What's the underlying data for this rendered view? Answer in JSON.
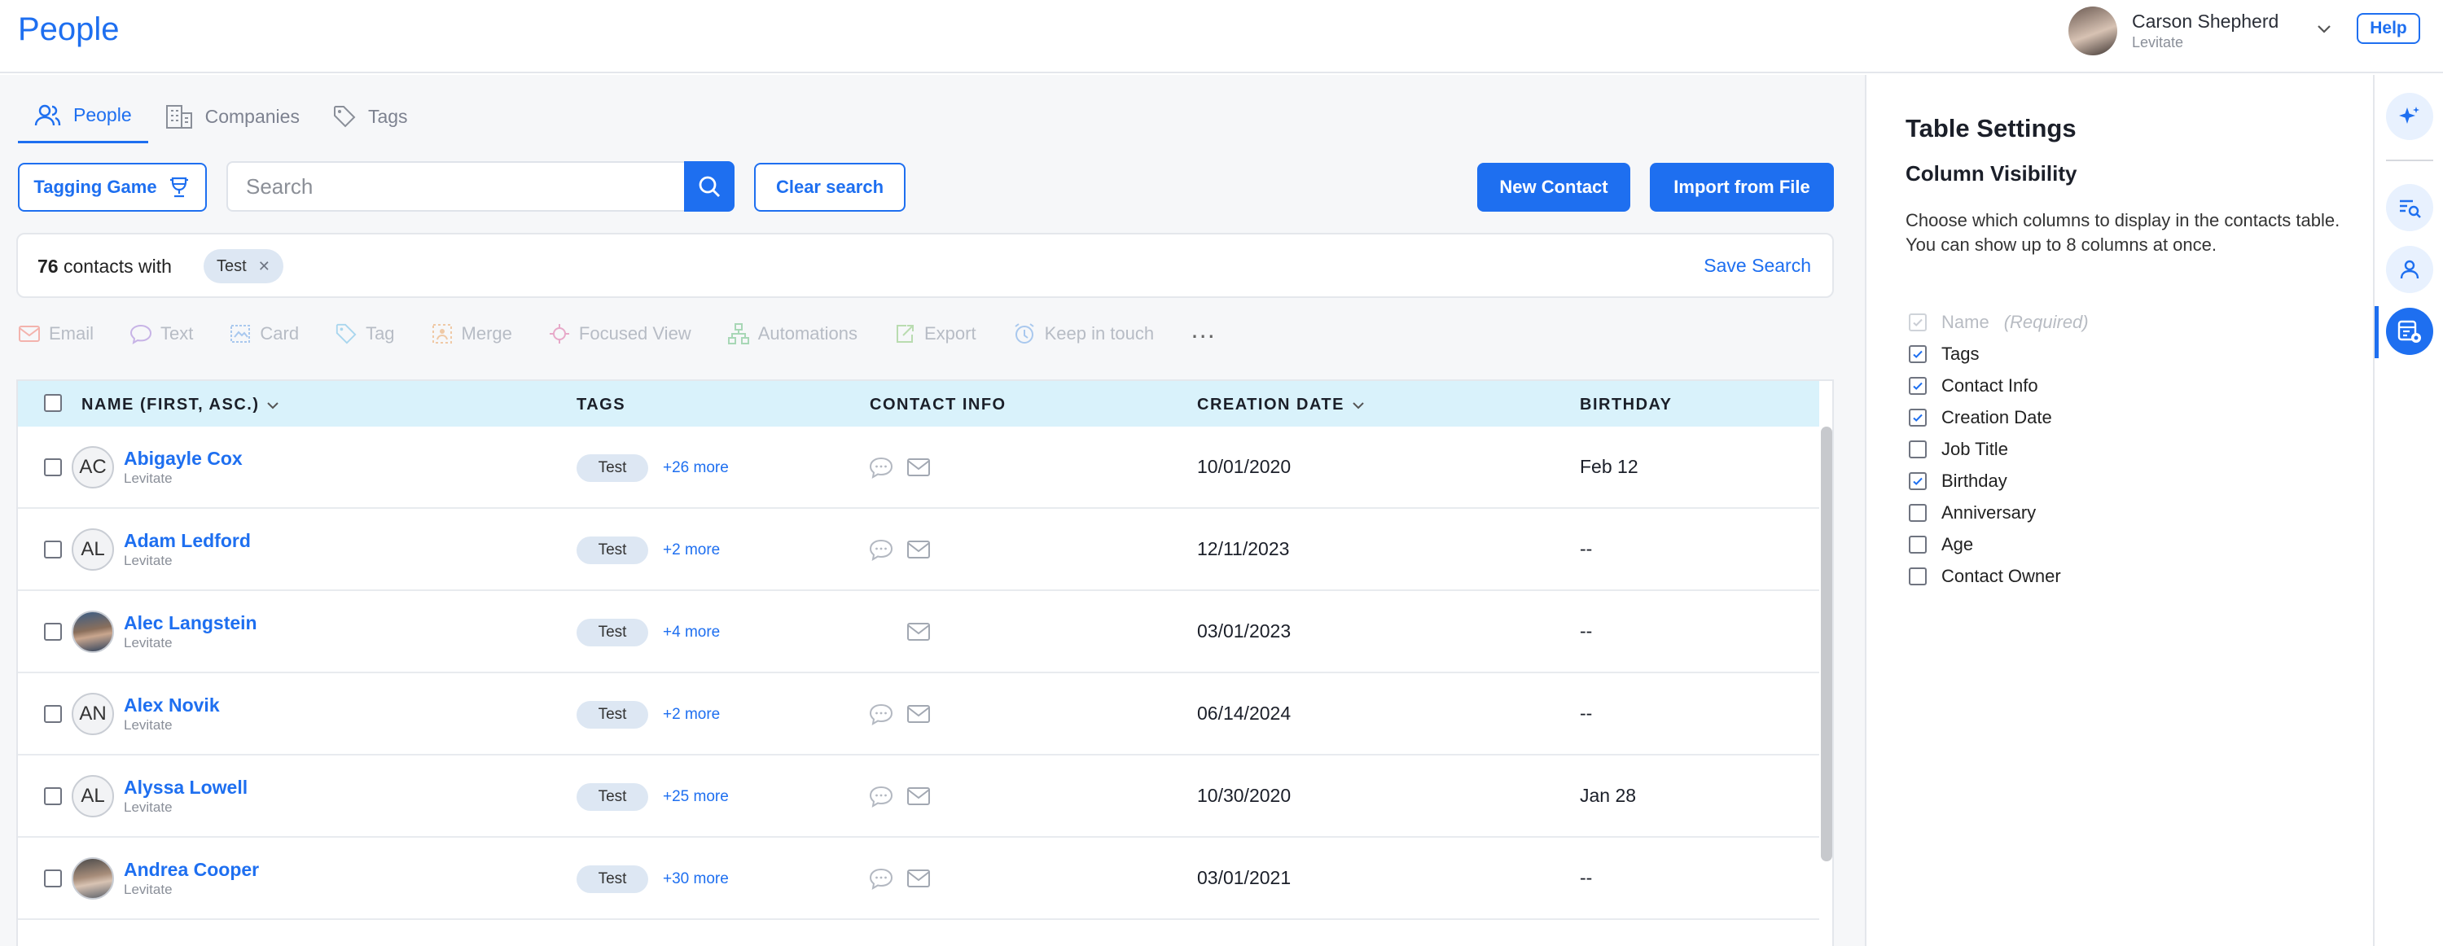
{
  "app": {
    "title": "People"
  },
  "user": {
    "name": "Carson Shepherd",
    "org": "Levitate",
    "help_label": "Help"
  },
  "tabs": [
    {
      "label": "People",
      "icon": "people-icon",
      "active": true
    },
    {
      "label": "Companies",
      "icon": "building-icon",
      "active": false
    },
    {
      "label": "Tags",
      "icon": "tag-icon",
      "active": false
    }
  ],
  "toolbar": {
    "tagging_game_label": "Tagging Game",
    "search_placeholder": "Search",
    "clear_search_label": "Clear search",
    "new_contact_label": "New Contact",
    "import_label": "Import from File"
  },
  "filter": {
    "count": "76",
    "count_suffix": "contacts with",
    "chip": "Test",
    "save_search_label": "Save Search"
  },
  "actions": [
    {
      "label": "Email",
      "icon": "email-icon"
    },
    {
      "label": "Text",
      "icon": "chat-icon"
    },
    {
      "label": "Card",
      "icon": "card-icon"
    },
    {
      "label": "Tag",
      "icon": "tag-icon"
    },
    {
      "label": "Merge",
      "icon": "merge-icon"
    },
    {
      "label": "Focused View",
      "icon": "focus-icon"
    },
    {
      "label": "Automations",
      "icon": "automations-icon"
    },
    {
      "label": "Export",
      "icon": "export-icon"
    },
    {
      "label": "Keep in touch",
      "icon": "alarm-clock-icon"
    }
  ],
  "table": {
    "headers": {
      "name": "NAME (FIRST, ASC.)",
      "tags": "TAGS",
      "contact_info": "CONTACT INFO",
      "creation_date": "CREATION DATE",
      "birthday": "BIRTHDAY"
    },
    "rows": [
      {
        "initials": "AC",
        "photo": false,
        "name": "Abigayle Cox",
        "company": "Levitate",
        "tag": "Test",
        "more": "+26 more",
        "has_chat": true,
        "has_email": true,
        "created": "10/01/2020",
        "birthday": "Feb 12"
      },
      {
        "initials": "AL",
        "photo": false,
        "name": "Adam Ledford",
        "company": "Levitate",
        "tag": "Test",
        "more": "+2 more",
        "has_chat": true,
        "has_email": true,
        "created": "12/11/2023",
        "birthday": "--"
      },
      {
        "initials": "",
        "photo": "male",
        "name": "Alec Langstein",
        "company": "Levitate",
        "tag": "Test",
        "more": "+4 more",
        "has_chat": false,
        "has_email": true,
        "created": "03/01/2023",
        "birthday": "--"
      },
      {
        "initials": "AN",
        "photo": false,
        "name": "Alex Novik",
        "company": "Levitate",
        "tag": "Test",
        "more": "+2 more",
        "has_chat": true,
        "has_email": true,
        "created": "06/14/2024",
        "birthday": "--"
      },
      {
        "initials": "AL",
        "photo": false,
        "name": "Alyssa Lowell",
        "company": "Levitate",
        "tag": "Test",
        "more": "+25 more",
        "has_chat": true,
        "has_email": true,
        "created": "10/30/2020",
        "birthday": "Jan 28"
      },
      {
        "initials": "",
        "photo": "female",
        "name": "Andrea Cooper",
        "company": "Levitate",
        "tag": "Test",
        "more": "+30 more",
        "has_chat": true,
        "has_email": true,
        "created": "03/01/2021",
        "birthday": "--"
      }
    ]
  },
  "settings": {
    "title": "Table Settings",
    "subtitle": "Column Visibility",
    "description": "Choose which columns to display in the contacts table. You can show up to 8 columns at once.",
    "columns": [
      {
        "label": "Name",
        "suffix": "(Required)",
        "checked": true,
        "disabled": true
      },
      {
        "label": "Tags",
        "checked": true
      },
      {
        "label": "Contact Info",
        "checked": true
      },
      {
        "label": "Creation Date",
        "checked": true
      },
      {
        "label": "Job Title",
        "checked": false
      },
      {
        "label": "Birthday",
        "checked": true
      },
      {
        "label": "Anniversary",
        "checked": false
      },
      {
        "label": "Age",
        "checked": false
      },
      {
        "label": "Contact Owner",
        "checked": false
      }
    ]
  },
  "rail": [
    {
      "icon": "sparkle-icon",
      "active": false
    },
    {
      "icon": "search-list-icon",
      "active": false
    },
    {
      "icon": "person-icon",
      "active": false
    },
    {
      "icon": "table-settings-icon",
      "active": true
    }
  ],
  "colors": {
    "accent": "#1e6ff0",
    "header_bg": "#d9f2fb",
    "tag_bg": "#dde7f3",
    "muted": "#8a8f99"
  }
}
